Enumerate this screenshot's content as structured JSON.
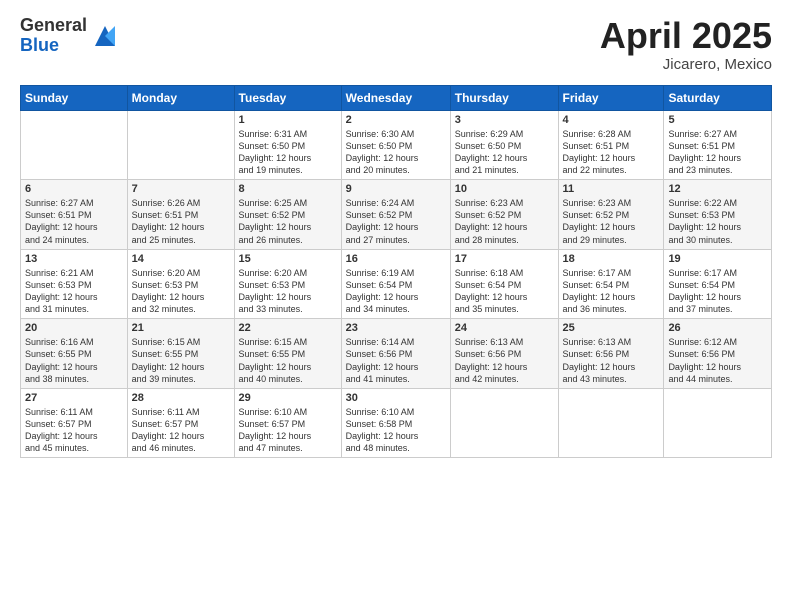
{
  "logo": {
    "general": "General",
    "blue": "Blue"
  },
  "header": {
    "month": "April 2025",
    "location": "Jicarero, Mexico"
  },
  "days_of_week": [
    "Sunday",
    "Monday",
    "Tuesday",
    "Wednesday",
    "Thursday",
    "Friday",
    "Saturday"
  ],
  "weeks": [
    [
      {
        "day": null,
        "info": null
      },
      {
        "day": null,
        "info": null
      },
      {
        "day": "1",
        "sunrise": "6:31 AM",
        "sunset": "6:50 PM",
        "daylight": "12 hours and 19 minutes."
      },
      {
        "day": "2",
        "sunrise": "6:30 AM",
        "sunset": "6:50 PM",
        "daylight": "12 hours and 20 minutes."
      },
      {
        "day": "3",
        "sunrise": "6:29 AM",
        "sunset": "6:50 PM",
        "daylight": "12 hours and 21 minutes."
      },
      {
        "day": "4",
        "sunrise": "6:28 AM",
        "sunset": "6:51 PM",
        "daylight": "12 hours and 22 minutes."
      },
      {
        "day": "5",
        "sunrise": "6:27 AM",
        "sunset": "6:51 PM",
        "daylight": "12 hours and 23 minutes."
      }
    ],
    [
      {
        "day": "6",
        "sunrise": "6:27 AM",
        "sunset": "6:51 PM",
        "daylight": "12 hours and 24 minutes."
      },
      {
        "day": "7",
        "sunrise": "6:26 AM",
        "sunset": "6:51 PM",
        "daylight": "12 hours and 25 minutes."
      },
      {
        "day": "8",
        "sunrise": "6:25 AM",
        "sunset": "6:52 PM",
        "daylight": "12 hours and 26 minutes."
      },
      {
        "day": "9",
        "sunrise": "6:24 AM",
        "sunset": "6:52 PM",
        "daylight": "12 hours and 27 minutes."
      },
      {
        "day": "10",
        "sunrise": "6:23 AM",
        "sunset": "6:52 PM",
        "daylight": "12 hours and 28 minutes."
      },
      {
        "day": "11",
        "sunrise": "6:23 AM",
        "sunset": "6:52 PM",
        "daylight": "12 hours and 29 minutes."
      },
      {
        "day": "12",
        "sunrise": "6:22 AM",
        "sunset": "6:53 PM",
        "daylight": "12 hours and 30 minutes."
      }
    ],
    [
      {
        "day": "13",
        "sunrise": "6:21 AM",
        "sunset": "6:53 PM",
        "daylight": "12 hours and 31 minutes."
      },
      {
        "day": "14",
        "sunrise": "6:20 AM",
        "sunset": "6:53 PM",
        "daylight": "12 hours and 32 minutes."
      },
      {
        "day": "15",
        "sunrise": "6:20 AM",
        "sunset": "6:53 PM",
        "daylight": "12 hours and 33 minutes."
      },
      {
        "day": "16",
        "sunrise": "6:19 AM",
        "sunset": "6:54 PM",
        "daylight": "12 hours and 34 minutes."
      },
      {
        "day": "17",
        "sunrise": "6:18 AM",
        "sunset": "6:54 PM",
        "daylight": "12 hours and 35 minutes."
      },
      {
        "day": "18",
        "sunrise": "6:17 AM",
        "sunset": "6:54 PM",
        "daylight": "12 hours and 36 minutes."
      },
      {
        "day": "19",
        "sunrise": "6:17 AM",
        "sunset": "6:54 PM",
        "daylight": "12 hours and 37 minutes."
      }
    ],
    [
      {
        "day": "20",
        "sunrise": "6:16 AM",
        "sunset": "6:55 PM",
        "daylight": "12 hours and 38 minutes."
      },
      {
        "day": "21",
        "sunrise": "6:15 AM",
        "sunset": "6:55 PM",
        "daylight": "12 hours and 39 minutes."
      },
      {
        "day": "22",
        "sunrise": "6:15 AM",
        "sunset": "6:55 PM",
        "daylight": "12 hours and 40 minutes."
      },
      {
        "day": "23",
        "sunrise": "6:14 AM",
        "sunset": "6:56 PM",
        "daylight": "12 hours and 41 minutes."
      },
      {
        "day": "24",
        "sunrise": "6:13 AM",
        "sunset": "6:56 PM",
        "daylight": "12 hours and 42 minutes."
      },
      {
        "day": "25",
        "sunrise": "6:13 AM",
        "sunset": "6:56 PM",
        "daylight": "12 hours and 43 minutes."
      },
      {
        "day": "26",
        "sunrise": "6:12 AM",
        "sunset": "6:56 PM",
        "daylight": "12 hours and 44 minutes."
      }
    ],
    [
      {
        "day": "27",
        "sunrise": "6:11 AM",
        "sunset": "6:57 PM",
        "daylight": "12 hours and 45 minutes."
      },
      {
        "day": "28",
        "sunrise": "6:11 AM",
        "sunset": "6:57 PM",
        "daylight": "12 hours and 46 minutes."
      },
      {
        "day": "29",
        "sunrise": "6:10 AM",
        "sunset": "6:57 PM",
        "daylight": "12 hours and 47 minutes."
      },
      {
        "day": "30",
        "sunrise": "6:10 AM",
        "sunset": "6:58 PM",
        "daylight": "12 hours and 48 minutes."
      },
      {
        "day": null,
        "info": null
      },
      {
        "day": null,
        "info": null
      },
      {
        "day": null,
        "info": null
      }
    ]
  ],
  "labels": {
    "sunrise_prefix": "Sunrise: ",
    "sunset_prefix": "Sunset: ",
    "daylight_prefix": "Daylight: "
  }
}
